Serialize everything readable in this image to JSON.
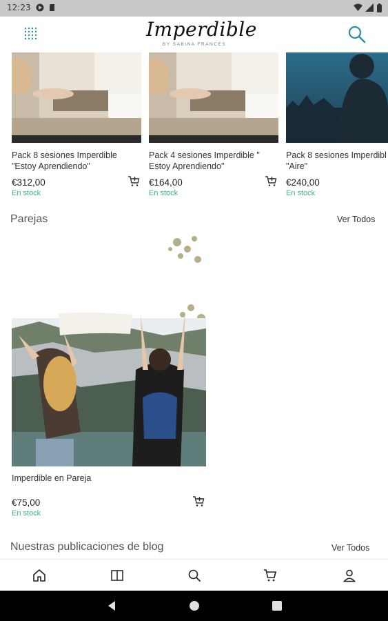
{
  "status_bar": {
    "time": "12:23",
    "left_icons": [
      "media-icon",
      "sd-card-icon"
    ],
    "right_icons": [
      "wifi-icon",
      "signal-icon",
      "battery-icon"
    ]
  },
  "app_bar": {
    "logo_text": "Imperdible",
    "logo_subtitle": "BY SABINA FRANCES",
    "menu_icon": "grid-menu-icon",
    "search_icon": "search-icon"
  },
  "products": [
    {
      "name": "Pack 8 sesiones Imperdible\n\"Estoy Aprendiendo\"",
      "price": "€312,00",
      "stock": "En stock"
    },
    {
      "name": "Pack 4 sesiones Imperdible \"\nEstoy Aprendiendo\"",
      "price": "€164,00",
      "stock": "En stock"
    },
    {
      "name": "Pack 8 sesiones Imperdibl\n\"Aire\"",
      "price": "€240,00",
      "stock": "En stock"
    }
  ],
  "sections": {
    "couples": {
      "title": "Parejas",
      "see_all": "Ver Todos"
    },
    "blog": {
      "title": "Nuestras publicaciones de blog",
      "see_all": "Ver Todos"
    }
  },
  "couple_product": {
    "name": "Imperdible en Pareja",
    "price": "€75,00",
    "stock": "En stock"
  },
  "bottom_nav": [
    "home-icon",
    "book-icon",
    "search-icon",
    "cart-icon",
    "profile-icon"
  ],
  "colors": {
    "accent": "#3cb878",
    "teal": "#2a8f9a",
    "status_bar": "#c9c9c9"
  }
}
